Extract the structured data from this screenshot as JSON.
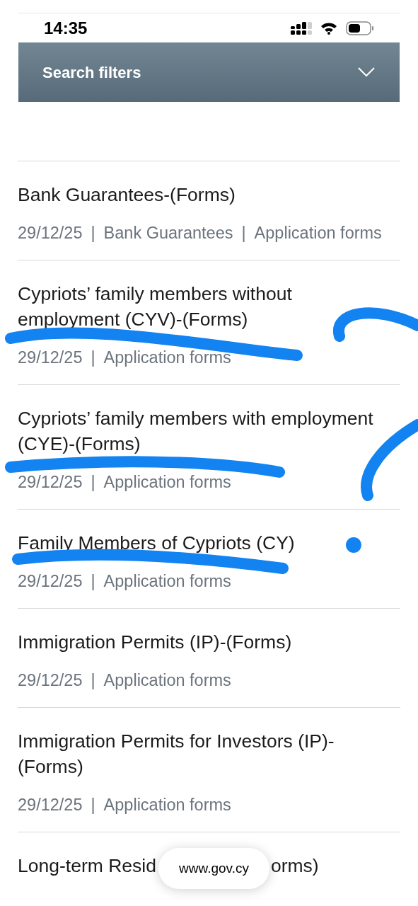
{
  "status_bar": {
    "time": "14:35"
  },
  "filters": {
    "title": "Search filters",
    "expanded": false
  },
  "results": [
    {
      "title_parts": [
        "Bank Guarantees-(Forms)"
      ],
      "meta": [
        "29/12/25",
        "|",
        "Bank Guarantees",
        "|",
        "Application forms"
      ]
    },
    {
      "title_parts": [
        "Cypriots’ family members without employment (CYV)-(Forms)"
      ],
      "meta": [
        "29/12/25",
        "|",
        "Application forms"
      ]
    },
    {
      "title_parts": [
        "Cypriots’ family members with employment (CYE)-(Forms)"
      ],
      "meta": [
        "29/12/25",
        "|",
        "Application forms"
      ]
    },
    {
      "title_parts": [
        "Family Members of Cypriots (CY)"
      ],
      "meta": [
        "29/12/25",
        "|",
        "Application forms"
      ]
    },
    {
      "title_parts": [
        "Immigration Permits (IP)-(Forms)"
      ],
      "meta": [
        "29/12/25",
        "|",
        "Application forms"
      ]
    },
    {
      "title_parts": [
        "Immigration Permits for Investors (IP)-(Forms)"
      ],
      "meta": [
        "29/12/25",
        "|",
        "Application forms"
      ]
    },
    {
      "title_parts": [
        "Long-term Resid",
        "orms)"
      ]
    }
  ],
  "address_pill": {
    "url": "www.gov.cy"
  }
}
